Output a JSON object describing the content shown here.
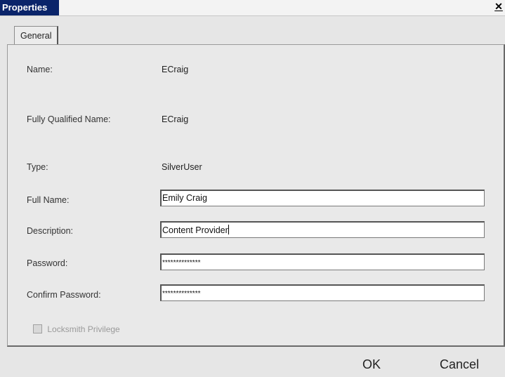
{
  "window": {
    "title": "Properties",
    "close_glyph": "✕"
  },
  "tabs": [
    {
      "label": "General",
      "active": true
    }
  ],
  "fields": {
    "name": {
      "label": "Name:",
      "value": "ECraig"
    },
    "fqn": {
      "label": "Fully Qualified Name:",
      "value": "ECraig"
    },
    "type": {
      "label": "Type:",
      "value": "SilverUser"
    },
    "full_name": {
      "label": "Full Name:",
      "value": "Emily Craig"
    },
    "description": {
      "label": "Description:",
      "value": "Content Provider"
    },
    "password": {
      "label": "Password:",
      "value": "**************"
    },
    "confirm_password": {
      "label": "Confirm Password:",
      "value": "**************"
    }
  },
  "locksmith": {
    "label": "Locksmith Privilege",
    "checked": false,
    "enabled": false
  },
  "buttons": {
    "ok": "OK",
    "cancel": "Cancel"
  },
  "colors": {
    "title_accent": "#0a246a",
    "panel_bg": "#e9e9e9"
  },
  "icons": {
    "close": "close-icon",
    "checkbox": "checkbox-icon"
  }
}
